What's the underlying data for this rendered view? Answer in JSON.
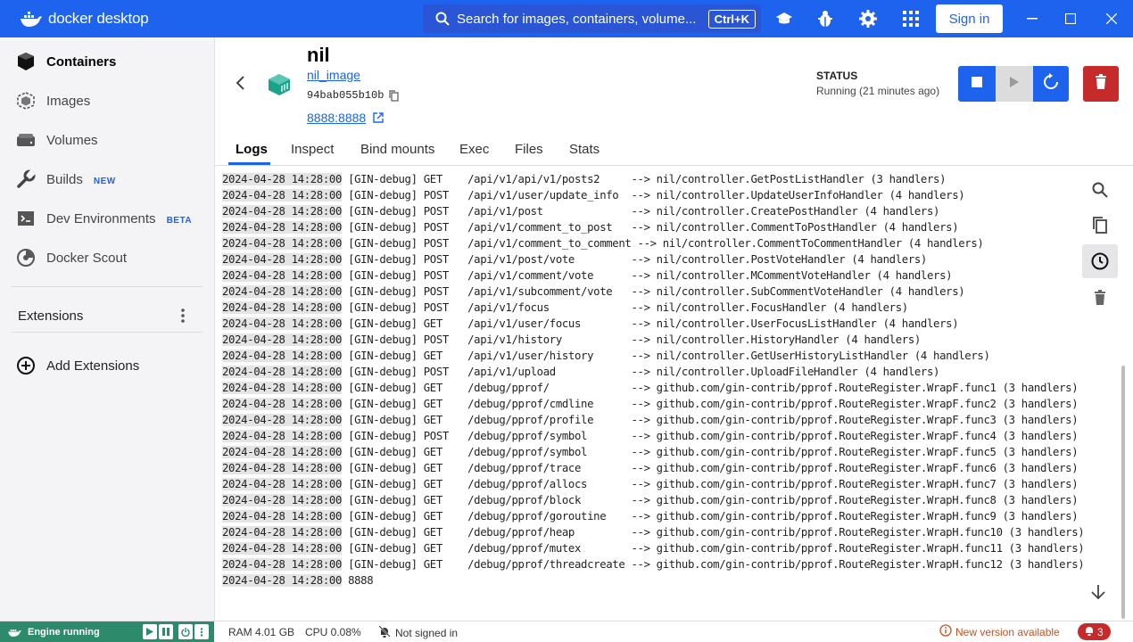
{
  "titlebar": {
    "brand": "docker desktop",
    "search_placeholder": "Search for images, containers, volume...",
    "search_shortcut": "Ctrl+K",
    "signin_label": "Sign in"
  },
  "sidebar": {
    "items": [
      {
        "label": "Containers",
        "icon": "containers-icon",
        "active": true
      },
      {
        "label": "Images",
        "icon": "images-icon"
      },
      {
        "label": "Volumes",
        "icon": "volumes-icon"
      },
      {
        "label": "Builds",
        "icon": "builds-icon",
        "badge": "NEW"
      },
      {
        "label": "Dev Environments",
        "icon": "dev-environments-icon",
        "badge": "BETA"
      },
      {
        "label": "Docker Scout",
        "icon": "docker-scout-icon"
      }
    ],
    "extensions_title": "Extensions",
    "add_extensions_label": "Add Extensions"
  },
  "container": {
    "name": "nil",
    "image": "nil_image",
    "id": "94bab055b10b",
    "port": "8888:8888",
    "status_label": "STATUS",
    "status_value": "Running (21 minutes ago)"
  },
  "tabs": [
    "Logs",
    "Inspect",
    "Bind mounts",
    "Exec",
    "Files",
    "Stats"
  ],
  "logs": [
    {
      "ts": "2024-04-28 14:28:00",
      "msg": " [GIN-debug] GET    /api/v1/api/v1/posts2     --> nil/controller.GetPostListHandler (3 handlers)"
    },
    {
      "ts": "2024-04-28 14:28:00",
      "msg": " [GIN-debug] POST   /api/v1/user/update_info  --> nil/controller.UpdateUserInfoHandler (4 handlers)"
    },
    {
      "ts": "2024-04-28 14:28:00",
      "msg": " [GIN-debug] POST   /api/v1/post              --> nil/controller.CreatePostHandler (4 handlers)"
    },
    {
      "ts": "2024-04-28 14:28:00",
      "msg": " [GIN-debug] POST   /api/v1/comment_to_post   --> nil/controller.CommentToPostHandler (4 handlers)"
    },
    {
      "ts": "2024-04-28 14:28:00",
      "msg": " [GIN-debug] POST   /api/v1/comment_to_comment --> nil/controller.CommentToCommentHandler (4 handlers)"
    },
    {
      "ts": "2024-04-28 14:28:00",
      "msg": " [GIN-debug] POST   /api/v1/post/vote         --> nil/controller.PostVoteHandler (4 handlers)"
    },
    {
      "ts": "2024-04-28 14:28:00",
      "msg": " [GIN-debug] POST   /api/v1/comment/vote      --> nil/controller.MCommentVoteHandler (4 handlers)"
    },
    {
      "ts": "2024-04-28 14:28:00",
      "msg": " [GIN-debug] POST   /api/v1/subcomment/vote   --> nil/controller.SubCommentVoteHandler (4 handlers)"
    },
    {
      "ts": "2024-04-28 14:28:00",
      "msg": " [GIN-debug] POST   /api/v1/focus             --> nil/controller.FocusHandler (4 handlers)"
    },
    {
      "ts": "2024-04-28 14:28:00",
      "msg": " [GIN-debug] GET    /api/v1/user/focus        --> nil/controller.UserFocusListHandler (4 handlers)"
    },
    {
      "ts": "2024-04-28 14:28:00",
      "msg": " [GIN-debug] POST   /api/v1/history           --> nil/controller.HistoryHandler (4 handlers)"
    },
    {
      "ts": "2024-04-28 14:28:00",
      "msg": " [GIN-debug] GET    /api/v1/user/history      --> nil/controller.GetUserHistoryListHandler (4 handlers)"
    },
    {
      "ts": "2024-04-28 14:28:00",
      "msg": " [GIN-debug] POST   /api/v1/upload            --> nil/controller.UploadFileHandler (4 handlers)"
    },
    {
      "ts": "2024-04-28 14:28:00",
      "msg": " [GIN-debug] GET    /debug/pprof/             --> github.com/gin-contrib/pprof.RouteRegister.WrapF.func1 (3 handlers)"
    },
    {
      "ts": "2024-04-28 14:28:00",
      "msg": " [GIN-debug] GET    /debug/pprof/cmdline      --> github.com/gin-contrib/pprof.RouteRegister.WrapF.func2 (3 handlers)"
    },
    {
      "ts": "2024-04-28 14:28:00",
      "msg": " [GIN-debug] GET    /debug/pprof/profile      --> github.com/gin-contrib/pprof.RouteRegister.WrapF.func3 (3 handlers)"
    },
    {
      "ts": "2024-04-28 14:28:00",
      "msg": " [GIN-debug] POST   /debug/pprof/symbol       --> github.com/gin-contrib/pprof.RouteRegister.WrapF.func4 (3 handlers)"
    },
    {
      "ts": "2024-04-28 14:28:00",
      "msg": " [GIN-debug] GET    /debug/pprof/symbol       --> github.com/gin-contrib/pprof.RouteRegister.WrapF.func5 (3 handlers)"
    },
    {
      "ts": "2024-04-28 14:28:00",
      "msg": " [GIN-debug] GET    /debug/pprof/trace        --> github.com/gin-contrib/pprof.RouteRegister.WrapF.func6 (3 handlers)"
    },
    {
      "ts": "2024-04-28 14:28:00",
      "msg": " [GIN-debug] GET    /debug/pprof/allocs       --> github.com/gin-contrib/pprof.RouteRegister.WrapH.func7 (3 handlers)"
    },
    {
      "ts": "2024-04-28 14:28:00",
      "msg": " [GIN-debug] GET    /debug/pprof/block        --> github.com/gin-contrib/pprof.RouteRegister.WrapH.func8 (3 handlers)"
    },
    {
      "ts": "2024-04-28 14:28:00",
      "msg": " [GIN-debug] GET    /debug/pprof/goroutine    --> github.com/gin-contrib/pprof.RouteRegister.WrapH.func9 (3 handlers)"
    },
    {
      "ts": "2024-04-28 14:28:00",
      "msg": " [GIN-debug] GET    /debug/pprof/heap         --> github.com/gin-contrib/pprof.RouteRegister.WrapH.func10 (3 handlers)"
    },
    {
      "ts": "2024-04-28 14:28:00",
      "msg": " [GIN-debug] GET    /debug/pprof/mutex        --> github.com/gin-contrib/pprof.RouteRegister.WrapH.func11 (3 handlers)"
    },
    {
      "ts": "2024-04-28 14:28:00",
      "msg": " [GIN-debug] GET    /debug/pprof/threadcreate --> github.com/gin-contrib/pprof.RouteRegister.WrapH.func12 (3 handlers)"
    },
    {
      "ts": "2024-04-28 14:28:00",
      "msg": " 8888"
    }
  ],
  "footer": {
    "engine_status": "Engine running",
    "ram": "RAM 4.01 GB",
    "cpu": "CPU 0.08%",
    "signin_status": "Not signed in",
    "new_version": "New version available",
    "notification_count": "3"
  },
  "colors": {
    "brand_blue": "#1d63ed",
    "danger_red": "#c62b2b",
    "engine_green": "#2d8a6b"
  }
}
